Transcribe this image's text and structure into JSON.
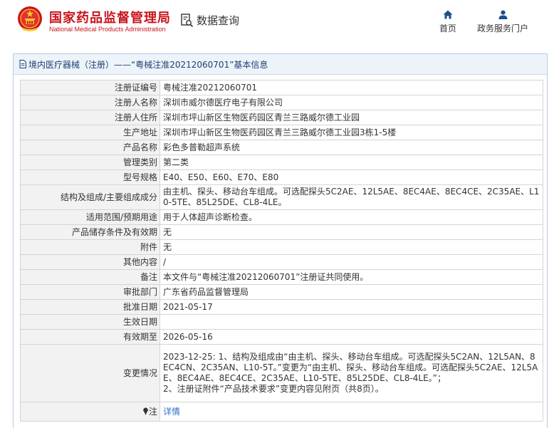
{
  "header": {
    "brand_cn": "国家药品监督管理局",
    "brand_en": "National Medical Products Administration",
    "query_label": "数据查询",
    "nav": [
      {
        "label": "首页",
        "icon": "home-icon"
      },
      {
        "label": "政务服务门户",
        "icon": "user-icon"
      }
    ]
  },
  "panel": {
    "title": "境内医疗器械（注册）——“粤械注准20212060701”基本信息"
  },
  "fields": [
    {
      "label": "注册证编号",
      "value": "粤械注准20212060701"
    },
    {
      "label": "注册人名称",
      "value": "深圳市威尔德医疗电子有限公司"
    },
    {
      "label": "注册人住所",
      "value": "深圳市坪山新区生物医药园区青兰三路威尔德工业园"
    },
    {
      "label": "生产地址",
      "value": "深圳市坪山新区生物医药园区青兰三路威尔德工业园3栋1-5楼"
    },
    {
      "label": "产品名称",
      "value": "彩色多普勒超声系统"
    },
    {
      "label": "管理类别",
      "value": "第二类"
    },
    {
      "label": "型号规格",
      "value": "E40、E50、E60、E70、E80"
    },
    {
      "label": "结构及组成/主要组成成分",
      "value": "由主机、探头、移动台车组成。可选配探头5C2AE、12L5AE、8EC4AE、8EC4CE、2C35AE、L10-5TE、85L25DE、CL8-4LE。"
    },
    {
      "label": "适用范围/预期用途",
      "value": "用于人体超声诊断检查。"
    },
    {
      "label": "产品储存条件及有效期",
      "value": "无"
    },
    {
      "label": "附件",
      "value": "无"
    },
    {
      "label": "其他内容",
      "value": "/"
    },
    {
      "label": "备注",
      "value": "本文件与“粤械注准20212060701”注册证共同使用。"
    },
    {
      "label": "审批部门",
      "value": "广东省药品监督管理局"
    },
    {
      "label": "批准日期",
      "value": "2021-05-17"
    },
    {
      "label": "生效日期",
      "value": ""
    },
    {
      "label": "有效期至",
      "value": "2026-05-16"
    },
    {
      "label": "变更情况",
      "value": "2023-12-25: 1、结构及组成由“由主机、探头、移动台车组成。可选配探头5C2AN、12L5AN、8EC4CN、2C35AN、L10-5T。”变更为“由主机、探头、移动台车组成。可选配探头5C2AE、12L5AE、8EC4AE、8EC4CE、2C35AE、L10-5TE、85L25DE、CL8-4LE。”；\n2、注册证附件“产品技术要求”变更内容见附页（共8页）。"
    },
    {
      "label": "注",
      "value": "详情"
    }
  ],
  "colors": {
    "brand": "#c8161d",
    "title_text": "#1f3f73",
    "link": "#2f6fc9",
    "label_bg": "#f2f2f2",
    "border": "#d4d4d4"
  }
}
